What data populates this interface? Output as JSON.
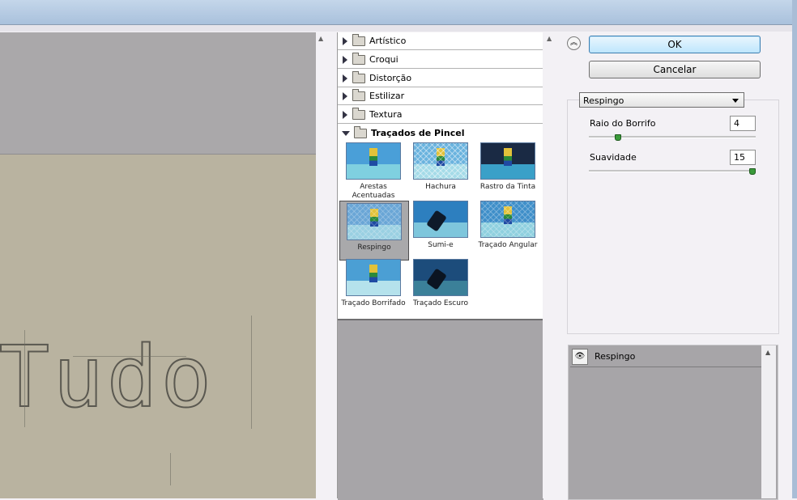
{
  "dialog": {
    "ok_label": "OK",
    "cancel_label": "Cancelar",
    "collapse_icon": "double-chevron-up-icon"
  },
  "categories": [
    {
      "label": "Artístico",
      "expanded": false
    },
    {
      "label": "Croqui",
      "expanded": false
    },
    {
      "label": "Distorção",
      "expanded": false
    },
    {
      "label": "Estilizar",
      "expanded": false
    },
    {
      "label": "Textura",
      "expanded": false
    },
    {
      "label": "Traçados de Pincel",
      "expanded": true
    }
  ],
  "filters": [
    {
      "label": "Arestas Acentuadas",
      "selected": false
    },
    {
      "label": "Hachura",
      "selected": false
    },
    {
      "label": "Rastro da Tinta",
      "selected": false
    },
    {
      "label": "Respingo",
      "selected": true
    },
    {
      "label": "Sumi-e",
      "selected": false
    },
    {
      "label": "Traçado Angular",
      "selected": false
    },
    {
      "label": "Traçado Borrifado",
      "selected": false
    },
    {
      "label": "Traçado Escuro",
      "selected": false
    }
  ],
  "settings": {
    "filter_select": "Respingo",
    "params": [
      {
        "label": "Raio do Borrifo",
        "value": "4",
        "slider_fraction": 0.16
      },
      {
        "label": "Suavidade",
        "value": "15",
        "slider_fraction": 1.0
      }
    ]
  },
  "layers": {
    "items": [
      {
        "name": "Respingo",
        "visible": true
      }
    ]
  }
}
